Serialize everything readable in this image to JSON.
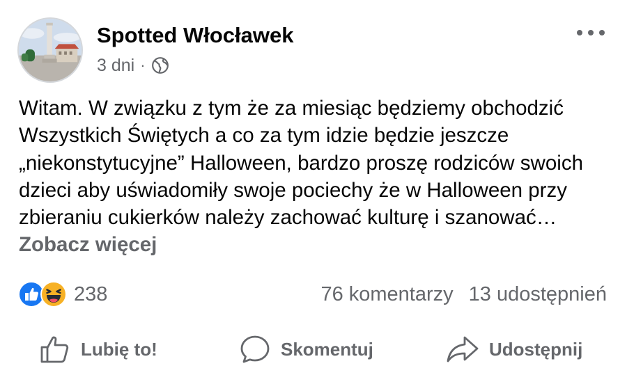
{
  "post": {
    "page_name": "Spotted Włocławek",
    "time": "3 dni",
    "separator": "·",
    "audience_icon": "globe-icon",
    "text": "Witam. W związku z tym że za miesiąc będziemy obchodzić Wszystkich Świętych a co za tym idzie będzie jeszcze „niekonstytucyjne” Halloween, bardzo proszę rodziców swoich dzieci aby uświadomiły swoje pociechy że w Halloween przy zbieraniu cukierków należy zachować kulturę i szanować",
    "ellipsis": "… ",
    "see_more": "Zobacz więcej"
  },
  "reactions": {
    "icons": [
      "like-reaction-icon",
      "haha-reaction-icon"
    ],
    "count": "238"
  },
  "stats": {
    "comments": "76 komentarzy",
    "shares": "13 udostępnień"
  },
  "actions": {
    "like": "Lubię to!",
    "comment": "Skomentuj",
    "share": "Udostępnij"
  },
  "colors": {
    "like_blue": "#1877f2",
    "haha_yellow": "#f7b125",
    "secondary_text": "#65676b",
    "primary_text": "#050505"
  }
}
